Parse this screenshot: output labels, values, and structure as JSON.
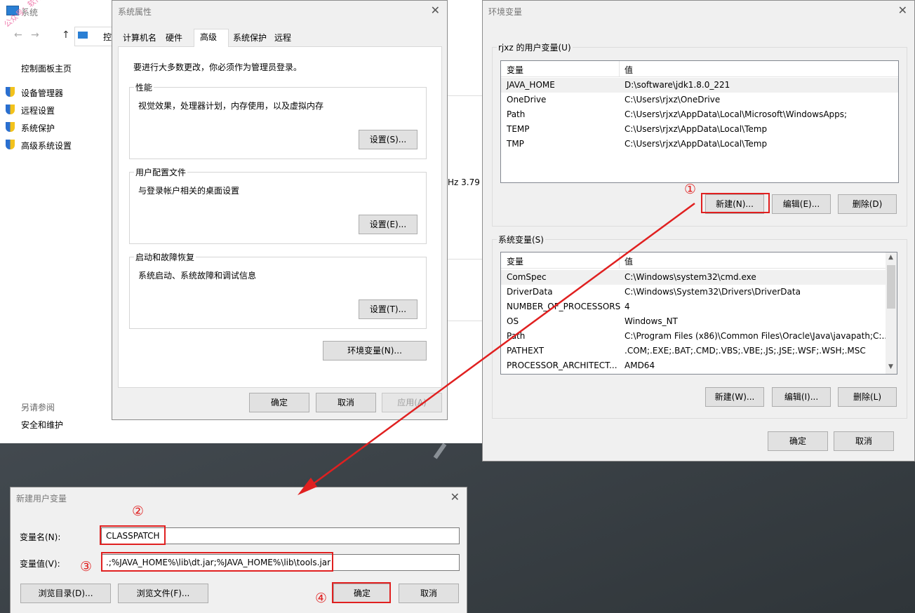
{
  "system_window": {
    "title": "系统",
    "address": "控",
    "sidebar": {
      "home": "控制面板主页",
      "items": [
        "设备管理器",
        "远程设置",
        "系统保护",
        "高级系统设置"
      ],
      "see_also": "另请参阅",
      "security": "安全和维护"
    },
    "cpu_fragment": "Hz   3.79",
    "watermark": "公众号：软件安排"
  },
  "sysprop": {
    "title": "系统属性",
    "tabs": [
      "计算机名",
      "硬件",
      "高级",
      "系统保护",
      "远程"
    ],
    "admin_note": "要进行大多数更改，你必须作为管理员登录。",
    "performance": {
      "label": "性能",
      "desc": "视觉效果，处理器计划，内存使用，以及虚拟内存",
      "button": "设置(S)..."
    },
    "profiles": {
      "label": "用户配置文件",
      "desc": "与登录帐户相关的桌面设置",
      "button": "设置(E)..."
    },
    "startup": {
      "label": "启动和故障恢复",
      "desc": "系统启动、系统故障和调试信息",
      "button": "设置(T)..."
    },
    "env_button": "环境变量(N)...",
    "ok": "确定",
    "cancel": "取消",
    "apply": "应用(A)"
  },
  "envvars": {
    "title": "环境变量",
    "user_group": "rjxz 的用户变量(U)",
    "col_var": "变量",
    "col_val": "值",
    "user_rows": [
      {
        "name": "JAVA_HOME",
        "value": "D:\\software\\jdk1.8.0_221"
      },
      {
        "name": "OneDrive",
        "value": "C:\\Users\\rjxz\\OneDrive"
      },
      {
        "name": "Path",
        "value": "C:\\Users\\rjxz\\AppData\\Local\\Microsoft\\WindowsApps;"
      },
      {
        "name": "TEMP",
        "value": "C:\\Users\\rjxz\\AppData\\Local\\Temp"
      },
      {
        "name": "TMP",
        "value": "C:\\Users\\rjxz\\AppData\\Local\\Temp"
      }
    ],
    "user_new": "新建(N)...",
    "user_edit": "编辑(E)...",
    "user_delete": "删除(D)",
    "sys_group": "系统变量(S)",
    "sys_rows": [
      {
        "name": "ComSpec",
        "value": "C:\\Windows\\system32\\cmd.exe"
      },
      {
        "name": "DriverData",
        "value": "C:\\Windows\\System32\\Drivers\\DriverData"
      },
      {
        "name": "NUMBER_OF_PROCESSORS",
        "value": "4"
      },
      {
        "name": "OS",
        "value": "Windows_NT"
      },
      {
        "name": "Path",
        "value": "C:\\Program Files (x86)\\Common Files\\Oracle\\Java\\javapath;C:..."
      },
      {
        "name": "PATHEXT",
        "value": ".COM;.EXE;.BAT;.CMD;.VBS;.VBE;.JS;.JSE;.WSF;.WSH;.MSC"
      },
      {
        "name": "PROCESSOR_ARCHITECT...",
        "value": "AMD64"
      }
    ],
    "sys_new": "新建(W)...",
    "sys_edit": "编辑(I)...",
    "sys_delete": "删除(L)",
    "ok": "确定",
    "cancel": "取消"
  },
  "newvar": {
    "title": "新建用户变量",
    "name_label": "变量名(N):",
    "name_value": "CLASSPATCH",
    "value_label": "变量值(V):",
    "value_value": ".;%JAVA_HOME%\\lib\\dt.jar;%JAVA_HOME%\\lib\\tools.jar",
    "browse_dir": "浏览目录(D)...",
    "browse_file": "浏览文件(F)...",
    "ok": "确定",
    "cancel": "取消"
  },
  "annotations": {
    "step1": "①",
    "step2": "②",
    "step3": "③",
    "step4": "④",
    "color": "#e02020"
  }
}
